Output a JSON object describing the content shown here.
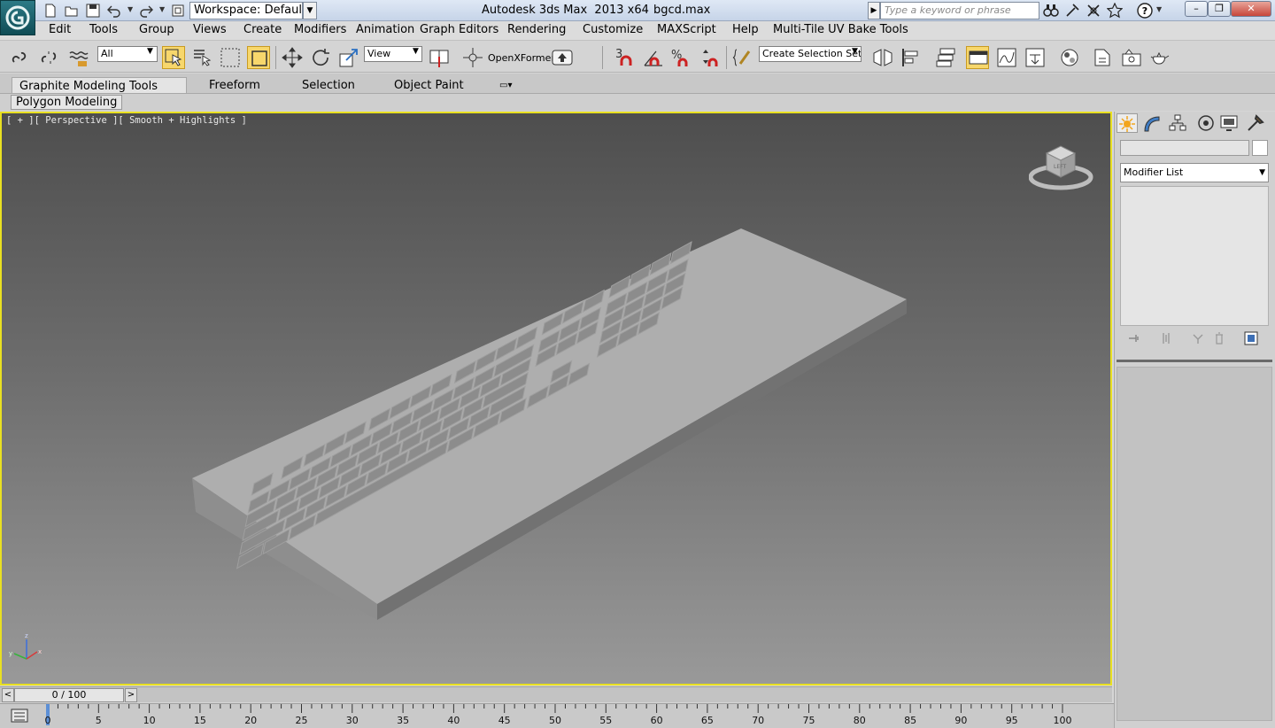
{
  "titlebar": {
    "workspace": "Workspace: Default",
    "app_title": "Autodesk 3ds Max  2013 x64",
    "file_name": "bgcd.max",
    "search_placeholder": "Type a keyword or phrase"
  },
  "menu": [
    "Edit",
    "Tools",
    "Group",
    "Views",
    "Create",
    "Modifiers",
    "Animation",
    "Graph Editors",
    "Rendering",
    "Customize",
    "MAXScript",
    "Help",
    "Multi-Tile UV Bake Tools"
  ],
  "toolbar": {
    "selection_filter": "All",
    "ref_coord": "View",
    "openxformer_label": "OpenXFormer",
    "snap_angle_label": "3",
    "named_selection_placeholder": "Create Selection Set"
  },
  "ribbon": {
    "tabs": [
      "Graphite Modeling Tools",
      "Freeform",
      "Selection",
      "Object Paint"
    ],
    "active_panel": "Polygon Modeling"
  },
  "viewport": {
    "label": "[ + ][ Perspective ][ Smooth + Highlights ]",
    "border_color": "#e9e021",
    "viewcube_face": "LEFT"
  },
  "command_panel": {
    "modifier_list": "Modifier List"
  },
  "timeline": {
    "frame_display": "0 / 100",
    "ticks": [
      "0",
      "5",
      "10",
      "15",
      "20",
      "25",
      "30",
      "35",
      "40",
      "45",
      "50",
      "55",
      "60",
      "65",
      "70",
      "75",
      "80",
      "85",
      "90",
      "95",
      "100"
    ]
  }
}
